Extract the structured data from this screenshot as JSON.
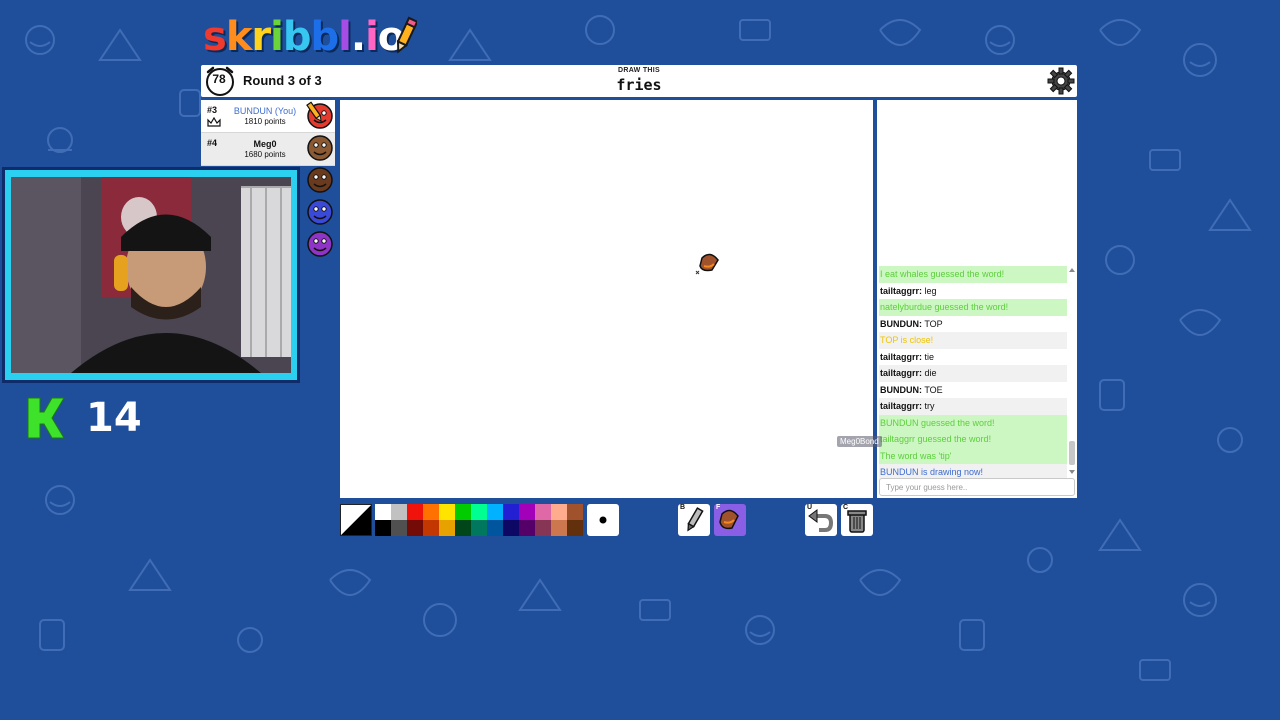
{
  "logo": {
    "text": "skribbl.io",
    "letters": [
      "s",
      "k",
      "r",
      "i",
      "b",
      "b",
      "l",
      ".",
      "i",
      "o"
    ],
    "colors": [
      "#ef3a2e",
      "#ff8d1e",
      "#ffd21e",
      "#6bd43a",
      "#36c6f0",
      "#1c6fe8",
      "#a64de6",
      "#ffffff",
      "#ff66c4",
      "#ffffff"
    ]
  },
  "header": {
    "timer": "78",
    "round": "Round 3 of 3",
    "hint_label": "DRAW THIS",
    "word": "fries"
  },
  "players": [
    {
      "rank": "#3",
      "name": "BUNDUN (You)",
      "points": "1810 points",
      "is_you": true,
      "crown": true,
      "avatar_color": "#e53b2e"
    },
    {
      "rank": "#4",
      "name": "Meg0",
      "points": "1680 points",
      "is_you": false,
      "crown": false,
      "avatar_color": "#8b5a32"
    }
  ],
  "extra_avatars": [
    {
      "color": "#6a3a1e"
    },
    {
      "color": "#3b49d8"
    },
    {
      "color": "#8f34c7"
    }
  ],
  "stream": {
    "k_count": "14"
  },
  "chat": {
    "messages": [
      {
        "type": "green",
        "text": "I eat whales guessed the word!"
      },
      {
        "type": "normal",
        "nick": "tailtaggrr:",
        "text": "leg"
      },
      {
        "type": "green",
        "text": "natelyburdue guessed the word!"
      },
      {
        "type": "normal",
        "nick": "BUNDUN:",
        "text": "TOP"
      },
      {
        "type": "yellow",
        "text": "TOP is close!"
      },
      {
        "type": "normal",
        "nick": "tailtaggrr:",
        "text": "tie"
      },
      {
        "type": "normal",
        "nick": "tailtaggrr:",
        "text": "die"
      },
      {
        "type": "normal",
        "nick": "BUNDUN:",
        "text": "TOE"
      },
      {
        "type": "normal",
        "nick": "tailtaggrr:",
        "text": "try"
      },
      {
        "type": "green",
        "text": "BUNDUN guessed the word!"
      },
      {
        "type": "green",
        "text": "tailtaggrr guessed the word!"
      },
      {
        "type": "green",
        "text": "The word was 'tip'"
      },
      {
        "type": "blue",
        "text": "BUNDUN is drawing now!"
      }
    ],
    "input_placeholder": "Type your guess here..",
    "drawer_tag": "Meg0Bond"
  },
  "toolbar": {
    "palette_top": [
      "#ffffff",
      "#c1c1c1",
      "#ef130b",
      "#ff7100",
      "#ffe400",
      "#00cc00",
      "#00ff91",
      "#00b2ff",
      "#231fd3",
      "#a300ba",
      "#df69a7",
      "#ffac8e",
      "#a0522d"
    ],
    "palette_bottom": [
      "#000000",
      "#505050",
      "#740b07",
      "#c23800",
      "#e8a200",
      "#004619",
      "#00785d",
      "#00569e",
      "#0e0865",
      "#550069",
      "#873554",
      "#cc774d",
      "#63300d"
    ],
    "brush_key": "B",
    "fill_key": "F",
    "undo_key": "U",
    "clear_key": "C"
  }
}
